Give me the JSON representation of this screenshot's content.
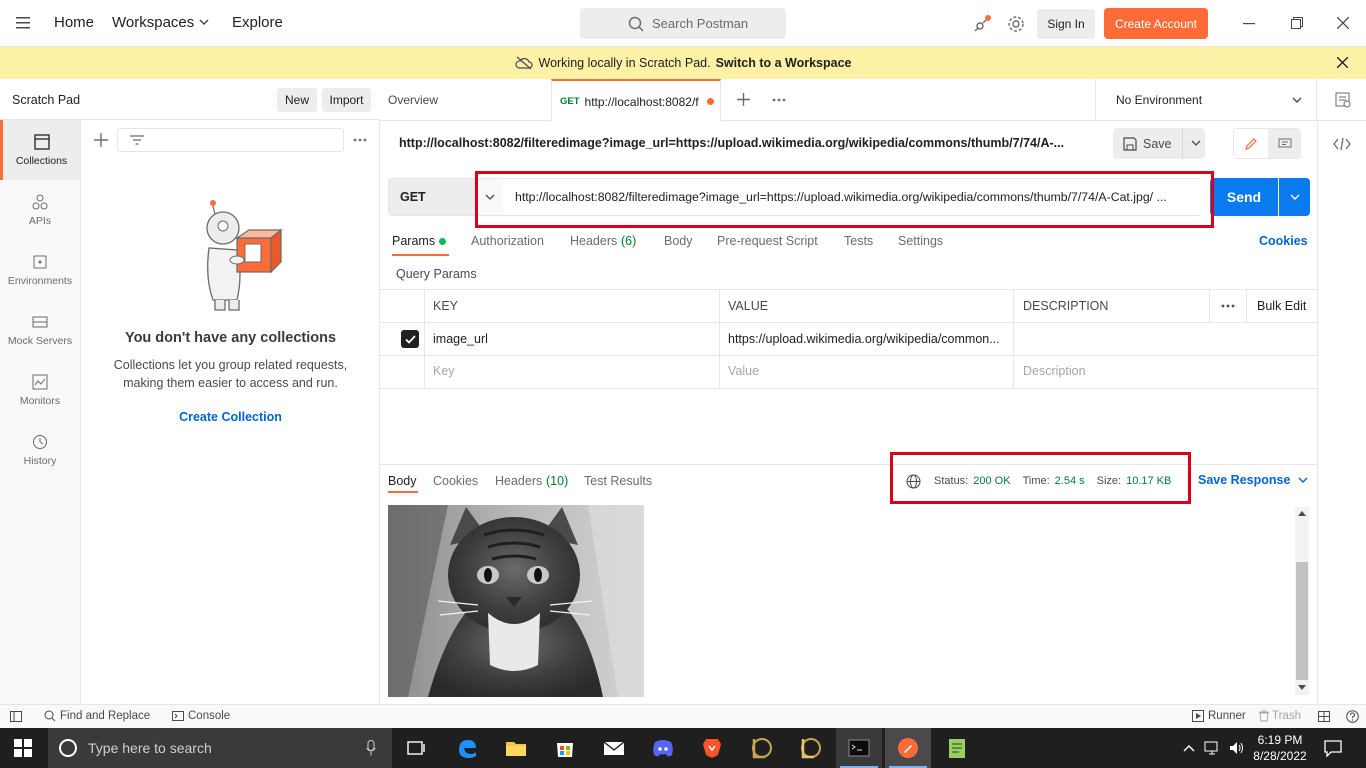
{
  "topbar": {
    "home": "Home",
    "workspaces": "Workspaces",
    "explore": "Explore",
    "search_placeholder": "Search Postman",
    "sign_in": "Sign In",
    "create_account": "Create Account"
  },
  "banner": {
    "text": "Working locally in Scratch Pad.",
    "link": "Switch to a Workspace"
  },
  "rail": {
    "items": [
      "Collections",
      "APIs",
      "Environments",
      "Mock Servers",
      "Monitors",
      "History"
    ]
  },
  "sidebar": {
    "title": "Scratch Pad",
    "new_label": "New",
    "import_label": "Import",
    "empty_title": "You don't have any collections",
    "empty_desc_line1": "Collections let you group related requests,",
    "empty_desc_line2": "making them easier to access and run.",
    "create_collection": "Create Collection"
  },
  "tabs": {
    "overview": "Overview",
    "active_method": "GET",
    "active_title": "http://localhost:8082/f",
    "environment": "No Environment"
  },
  "request": {
    "url_title": "http://localhost:8082/filteredimage?image_url=https://upload.wikimedia.org/wikipedia/commons/thumb/7/74/A-...",
    "save_label": "Save",
    "method": "GET",
    "url": "http://localhost:8082/filteredimage?image_url=https://upload.wikimedia.org/wikipedia/commons/thumb/7/74/A-Cat.jpg/ ...",
    "send_label": "Send",
    "subtabs": {
      "params": "Params",
      "authorization": "Authorization",
      "headers": "Headers",
      "headers_count": "(6)",
      "body": "Body",
      "prerequest": "Pre-request Script",
      "tests": "Tests",
      "settings": "Settings",
      "cookies": "Cookies"
    },
    "query_params_label": "Query Params",
    "table": {
      "col_key": "KEY",
      "col_value": "VALUE",
      "col_description": "DESCRIPTION",
      "bulk_edit": "Bulk Edit",
      "row_key": "image_url",
      "row_value": "https://upload.wikimedia.org/wikipedia/common...",
      "placeholder_key": "Key",
      "placeholder_value": "Value",
      "placeholder_description": "Description"
    }
  },
  "response": {
    "tabs": {
      "body": "Body",
      "cookies": "Cookies",
      "headers": "Headers",
      "headers_count": "(10)",
      "test_results": "Test Results"
    },
    "status_label": "Status:",
    "status_value": "200 OK",
    "time_label": "Time:",
    "time_value": "2.54 s",
    "size_label": "Size:",
    "size_value": "10.17 KB",
    "save_response": "Save Response"
  },
  "footer": {
    "find_replace": "Find and Replace",
    "console": "Console",
    "runner": "Runner",
    "trash": "Trash"
  },
  "taskbar": {
    "search_placeholder": "Type here to search",
    "time": "6:19 PM",
    "date": "8/28/2022"
  },
  "colors": {
    "accent": "#ff6c37",
    "send_blue": "#097bed",
    "status_green": "#007f31",
    "highlight_red": "#d9001b"
  }
}
